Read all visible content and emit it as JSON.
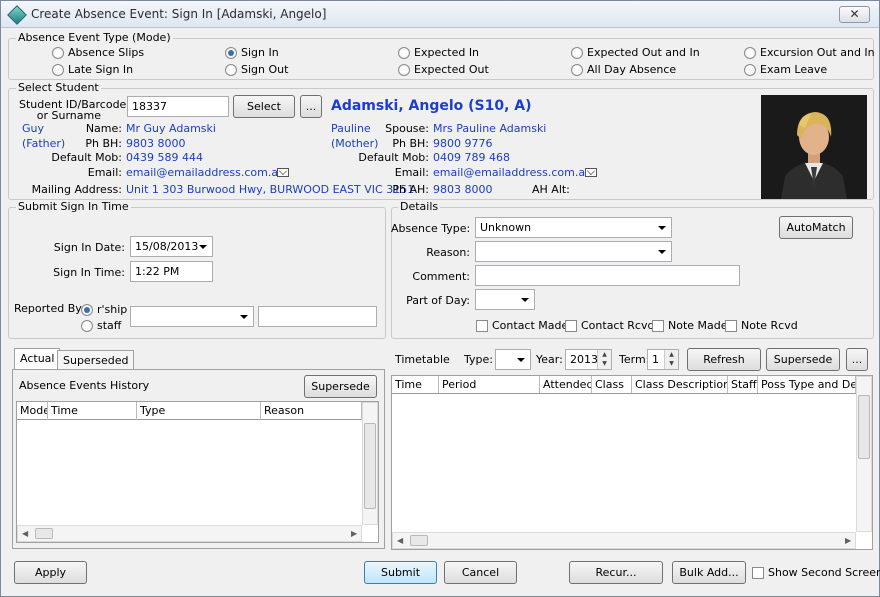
{
  "window": {
    "title": "Create Absence Event: Sign In [Adamski, Angelo]",
    "close_label": "✕"
  },
  "event_type": {
    "group_title": "Absence Event Type (Mode)",
    "options": [
      "Absence Slips",
      "Sign In",
      "Expected In",
      "Expected Out and In",
      "Excursion Out and In",
      "Late Sign In",
      "Sign Out",
      "Expected Out",
      "All Day Absence",
      "Exam Leave"
    ],
    "selected": "Sign In"
  },
  "student": {
    "group_title": "Select Student",
    "id_label": "Student ID/Barcode:",
    "id_label2": "or Surname",
    "id_value": "18337",
    "select_button": "Select",
    "more_button": "...",
    "display_name": "Adamski, Angelo (S10, A)",
    "parent1": {
      "first": "Guy",
      "relation": "(Father)",
      "name_label": "Name:",
      "name": "Mr Guy Adamski",
      "phbh_label": "Ph BH:",
      "phbh": "9803 8000",
      "mob_label": "Default Mob:",
      "mob": "0439 589 444",
      "email_label": "Email:",
      "email": "email@emailaddress.com.au",
      "address_label": "Mailing Address:",
      "address": "Unit 1 303 Burwood Hwy, BURWOOD EAST VIC 3151"
    },
    "parent2": {
      "first": "Pauline",
      "relation": "(Mother)",
      "name_label": "Spouse:",
      "name": "Mrs Pauline Adamski",
      "phbh_label": "Ph BH:",
      "phbh": "9800 9776",
      "mob_label": "Default Mob:",
      "mob": "0409 789 468",
      "email_label": "Email:",
      "email": "email@emailaddress.com.au",
      "phah_label": "Ph AH:",
      "phah": "9803 8000",
      "ahalt_label": "AH Alt:"
    }
  },
  "sign_in": {
    "group_title": "Submit Sign In Time",
    "date_label": "Sign In Date:",
    "date_value": "15/08/2013",
    "time_label": "Sign In Time:",
    "time_value": "1:22 PM",
    "reported_label": "Reported By:",
    "reported_options": [
      "r'ship",
      "staff"
    ],
    "reported_selected": "r'ship"
  },
  "details": {
    "group_title": "Details",
    "absence_type_label": "Absence Type:",
    "absence_type_value": "Unknown",
    "reason_label": "Reason:",
    "comment_label": "Comment:",
    "part_label": "Part of Day:",
    "automatch_button": "AutoMatch",
    "checks": [
      "Contact Made",
      "Contact Rcvd",
      "Note Made",
      "Note Rcvd"
    ]
  },
  "history": {
    "tabs": [
      "Actual",
      "Superseded"
    ],
    "active_tab": "Actual",
    "title": "Absence Events History",
    "supersede_button": "Supersede",
    "columns": [
      "Mode",
      "Time",
      "Type",
      "Reason"
    ]
  },
  "timetable": {
    "label": "Timetable",
    "type_label": "Type:",
    "year_label": "Year:",
    "year_value": "2013",
    "term_label": "Term:",
    "term_value": "1",
    "refresh_button": "Refresh",
    "supersede_button": "Supersede",
    "more_button": "...",
    "columns": [
      "Time",
      "Period",
      "Attended",
      "Class",
      "Class Description",
      "Staff",
      "Poss Type and Desc"
    ]
  },
  "footer": {
    "apply": "Apply",
    "submit": "Submit",
    "cancel": "Cancel",
    "recur": "Recur...",
    "bulk_add": "Bulk Add...",
    "show_second": "Show Second Screen"
  }
}
